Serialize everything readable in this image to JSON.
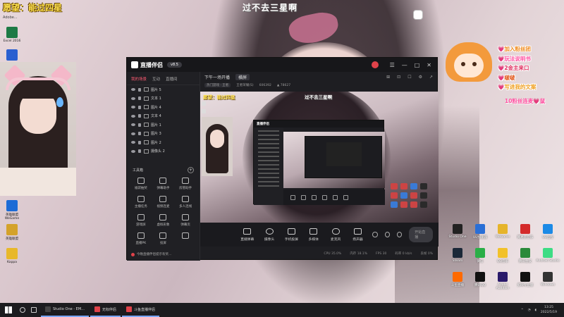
{
  "overlay": {
    "wish": "愿望：能过四星",
    "title": "过不去三星啊",
    "tiny_label": "Adobe..."
  },
  "left_desktop": [
    {
      "label": "Excel 2016",
      "color": "#1d7a45"
    },
    {
      "label": "",
      "color": "#2a5fd0"
    }
  ],
  "left_desktop_lower": [
    {
      "label": "英雄联盟WeGame",
      "color": "#1c6bd6"
    },
    {
      "label": "英雄联盟",
      "color": "#d4a22a"
    },
    {
      "label": "Kappa",
      "color": "#e8b82a"
    }
  ],
  "app": {
    "name": "直播伴侣",
    "version": "v8.5",
    "window_controls": [
      "☰",
      "—",
      "□",
      "✕"
    ],
    "tabs": [
      {
        "label": "我的场景",
        "active": true
      },
      {
        "label": "互动",
        "active": false
      },
      {
        "label": "直播间",
        "active": false
      }
    ],
    "sources": [
      "图片 5",
      "文本 1",
      "图片 4",
      "文本 4",
      "图片 1",
      "图片 3",
      "图片 2",
      "摄像头 2"
    ],
    "tools_header": "工具箱",
    "tools": [
      {
        "label": "福袋抽奖"
      },
      {
        "label": "弹幕助手"
      },
      {
        "label": "房管助手"
      },
      {
        "label": "主播任务"
      },
      {
        "label": "视频连麦"
      },
      {
        "label": "多人连线"
      },
      {
        "label": "游戏屏"
      },
      {
        "label": "虚拟形象"
      },
      {
        "label": "弹幕页"
      },
      {
        "label": "直播PK"
      },
      {
        "label": "投屏"
      },
      {
        "label": ""
      }
    ],
    "notice": "今晚直播伴侣提示有奖..."
  },
  "stage": {
    "scene_name": "下午一场开播",
    "mode_tag": "横屏",
    "stage_icons": [
      "⊞",
      "⊡",
      "☐",
      "⚙",
      "↗"
    ],
    "info": [
      "热门游戏 · 王者",
      "王者荣耀(S)",
      "606392",
      "▲ 78627"
    ],
    "preview_wish": "愿望：能过四星",
    "preview_title": "过不去三星啊",
    "nested_title": "直播伴侣"
  },
  "controls": [
    {
      "label": "直播弹幕"
    },
    {
      "label": "摄像头"
    },
    {
      "label": "手机投屏"
    },
    {
      "label": "多媒体"
    },
    {
      "label": "麦克风"
    },
    {
      "label": "扬声器"
    }
  ],
  "start_label": "开始直播",
  "status_bar": [
    "CPU 35.0%",
    "内存 18.1%",
    "FPS 30",
    "码率 0 kb/s",
    "丢帧 0%"
  ],
  "promo_lines": [
    {
      "text": "💗加入粉丝团",
      "color": "#f08a1a"
    },
    {
      "text": "💗玩法说明书",
      "color": "#ff4fa0"
    },
    {
      "text": "💗2金主来口",
      "color": "#e03060"
    },
    {
      "text": "💗啵啵",
      "color": "#e05010"
    },
    {
      "text": "💗写进我的文案",
      "color": "#f0a020"
    }
  ],
  "combo_text": "10粉丝连麦💗鼠",
  "right_desktop": [
    {
      "label": "Studio One",
      "color": "#222"
    },
    {
      "label": "UU加速器",
      "color": "#2a6fd6"
    },
    {
      "label": "WeGame",
      "color": "#e6b42a"
    },
    {
      "label": "网易云音乐",
      "color": "#d42a2a"
    },
    {
      "label": "UU远程",
      "color": "#1c8ae6"
    },
    {
      "label": "Steam",
      "color": "#1b2838"
    },
    {
      "label": "微信",
      "color": "#2aae47"
    },
    {
      "label": "QQ音乐",
      "color": "#f2c12a"
    },
    {
      "label": "腾讯会议",
      "color": "#2a8a3a"
    },
    {
      "label": "Android Studio",
      "color": "#3ddc84"
    },
    {
      "label": "斗鱼直播",
      "color": "#ff6a00"
    },
    {
      "label": "腾讯QQ",
      "color": "#111"
    },
    {
      "label": "Adobe Audition",
      "color": "#2a1a6a"
    },
    {
      "label": "剪映专业版",
      "color": "#111"
    },
    {
      "label": "Windows",
      "color": "#333"
    }
  ],
  "taskbar": {
    "apps": [
      {
        "label": "Studio One - EM...",
        "color": "#444"
      },
      {
        "label": "无标伴侣",
        "color": "#e0424a"
      },
      {
        "label": "斗鱼直播伴侣",
        "color": "#e0424a"
      }
    ],
    "time": "13:25",
    "date": "2022/5/19"
  }
}
